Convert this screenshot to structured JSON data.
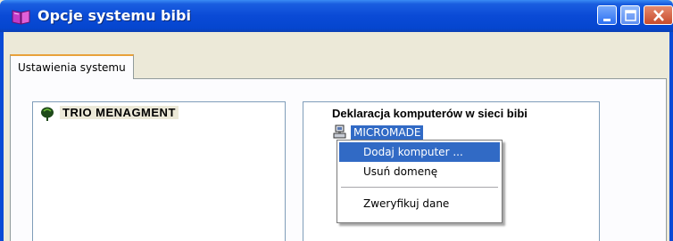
{
  "window": {
    "title": "Opcje systemu bibi",
    "app_icon": "book-icon",
    "controls": [
      "minimize-icon",
      "maximize-icon",
      "close-icon"
    ]
  },
  "tabs": [
    {
      "label": "Ustawienia systemu",
      "active": true
    }
  ],
  "left_panel": {
    "tree_root": {
      "label": "TRIO MENAGMENT",
      "icon": "balloon-icon"
    }
  },
  "right_panel": {
    "heading": "Deklaracja komputerów w sieci bibi",
    "node": {
      "label": "MICROMADE",
      "icon": "computer-icon",
      "selected": true
    }
  },
  "context_menu": {
    "items": [
      {
        "label": "Dodaj komputer ...",
        "highlighted": true
      },
      {
        "label": "Usuń domenę",
        "highlighted": false
      },
      {
        "label": "Zweryfikuj dane",
        "highlighted": false
      }
    ]
  },
  "colors": {
    "titlebar": "#0a4ad6",
    "selection": "#316ac5",
    "window_bg": "#ece9d8",
    "tab_accent": "#e8a13a"
  }
}
